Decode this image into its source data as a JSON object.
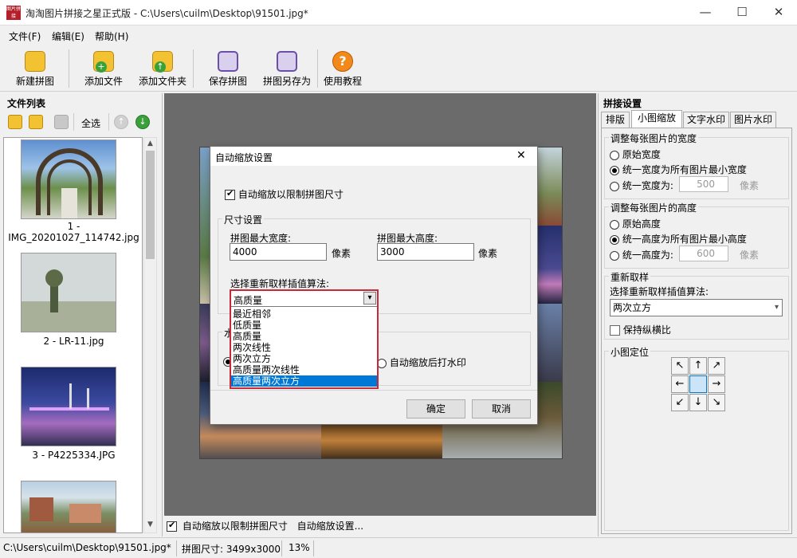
{
  "window": {
    "title": "淘淘图片拼接之星正式版 - C:\\Users\\cuilm\\Desktop\\91501.jpg*",
    "icon_text": "图片拼接",
    "minimize": "—",
    "maximize": "☐",
    "close": "✕"
  },
  "menu": [
    "文件(F)",
    "编辑(E)",
    "帮助(H)"
  ],
  "toolbar": [
    {
      "label": "新建拼图",
      "icon": "new-collage-icon"
    },
    {
      "label": "添加文件",
      "icon": "add-file-icon"
    },
    {
      "label": "添加文件夹",
      "icon": "add-folder-icon"
    },
    {
      "label": "保存拼图",
      "icon": "save-collage-icon"
    },
    {
      "label": "拼图另存为",
      "icon": "save-as-icon"
    },
    {
      "label": "使用教程",
      "icon": "help-icon"
    }
  ],
  "file_panel": {
    "title": "文件列表",
    "select_all": "全选",
    "files": [
      {
        "caption_line1": "1 -",
        "caption_line2": "IMG_20201027_114742.jpg"
      },
      {
        "caption_line1": "2 - LR-11.jpg",
        "caption_line2": ""
      },
      {
        "caption_line1": "3 - P4225334.JPG",
        "caption_line2": ""
      }
    ]
  },
  "canvas": {
    "auto_scale_label": "自动缩放以限制拼图尺寸",
    "auto_scale_link": "自动缩放设置...",
    "auto_scale_checked": true
  },
  "right_panel": {
    "title": "拼接设置",
    "tabs": [
      "排版",
      "小图缩放",
      "文字水印",
      "图片水印"
    ],
    "active_tab": "小图缩放",
    "width_group": {
      "title": "调整每张图片的宽度",
      "opt_original": "原始宽度",
      "opt_min": "统一宽度为所有图片最小宽度",
      "opt_fixed": "统一宽度为:",
      "value": "500",
      "unit": "像素"
    },
    "height_group": {
      "title": "调整每张图片的高度",
      "opt_original": "原始高度",
      "opt_min": "统一高度为所有图片最小高度",
      "opt_fixed": "统一高度为:",
      "value": "600",
      "unit": "像素"
    },
    "resample_group": {
      "title": "重新取样",
      "label": "选择重新取样插值算法:",
      "value": "两次立方",
      "keep_ratio": "保持纵横比"
    },
    "position_group": {
      "title": "小图定位",
      "arrows": [
        "↖",
        "↑",
        "↗",
        "←",
        "",
        "→",
        "↙",
        "↓",
        "↘"
      ]
    }
  },
  "status": {
    "path": "C:\\Users\\cuilm\\Desktop\\91501.jpg*",
    "size": "拼图尺寸: 3499x3000",
    "zoom": "13%"
  },
  "dialog": {
    "title": "自动缩放设置",
    "close": "✕",
    "enable_label": "自动缩放以限制拼图尺寸",
    "size_group": "尺寸设置",
    "max_width_label": "拼图最大宽度:",
    "max_width_value": "4000",
    "max_height_label": "拼图最大高度:",
    "max_height_value": "3000",
    "unit": "像素",
    "algo_label": "选择重新取样插值算法:",
    "algo_value": "高质量",
    "algo_options": [
      "最近相邻",
      "低质量",
      "高质量",
      "两次线性",
      "两次立方",
      "高质量两次线性",
      "高质量两次立方"
    ],
    "highlighted_option": "高质量两次立方",
    "watermark_group_partial": "水",
    "watermark_after": "自动缩放后打水印",
    "ok": "确定",
    "cancel": "取消"
  }
}
